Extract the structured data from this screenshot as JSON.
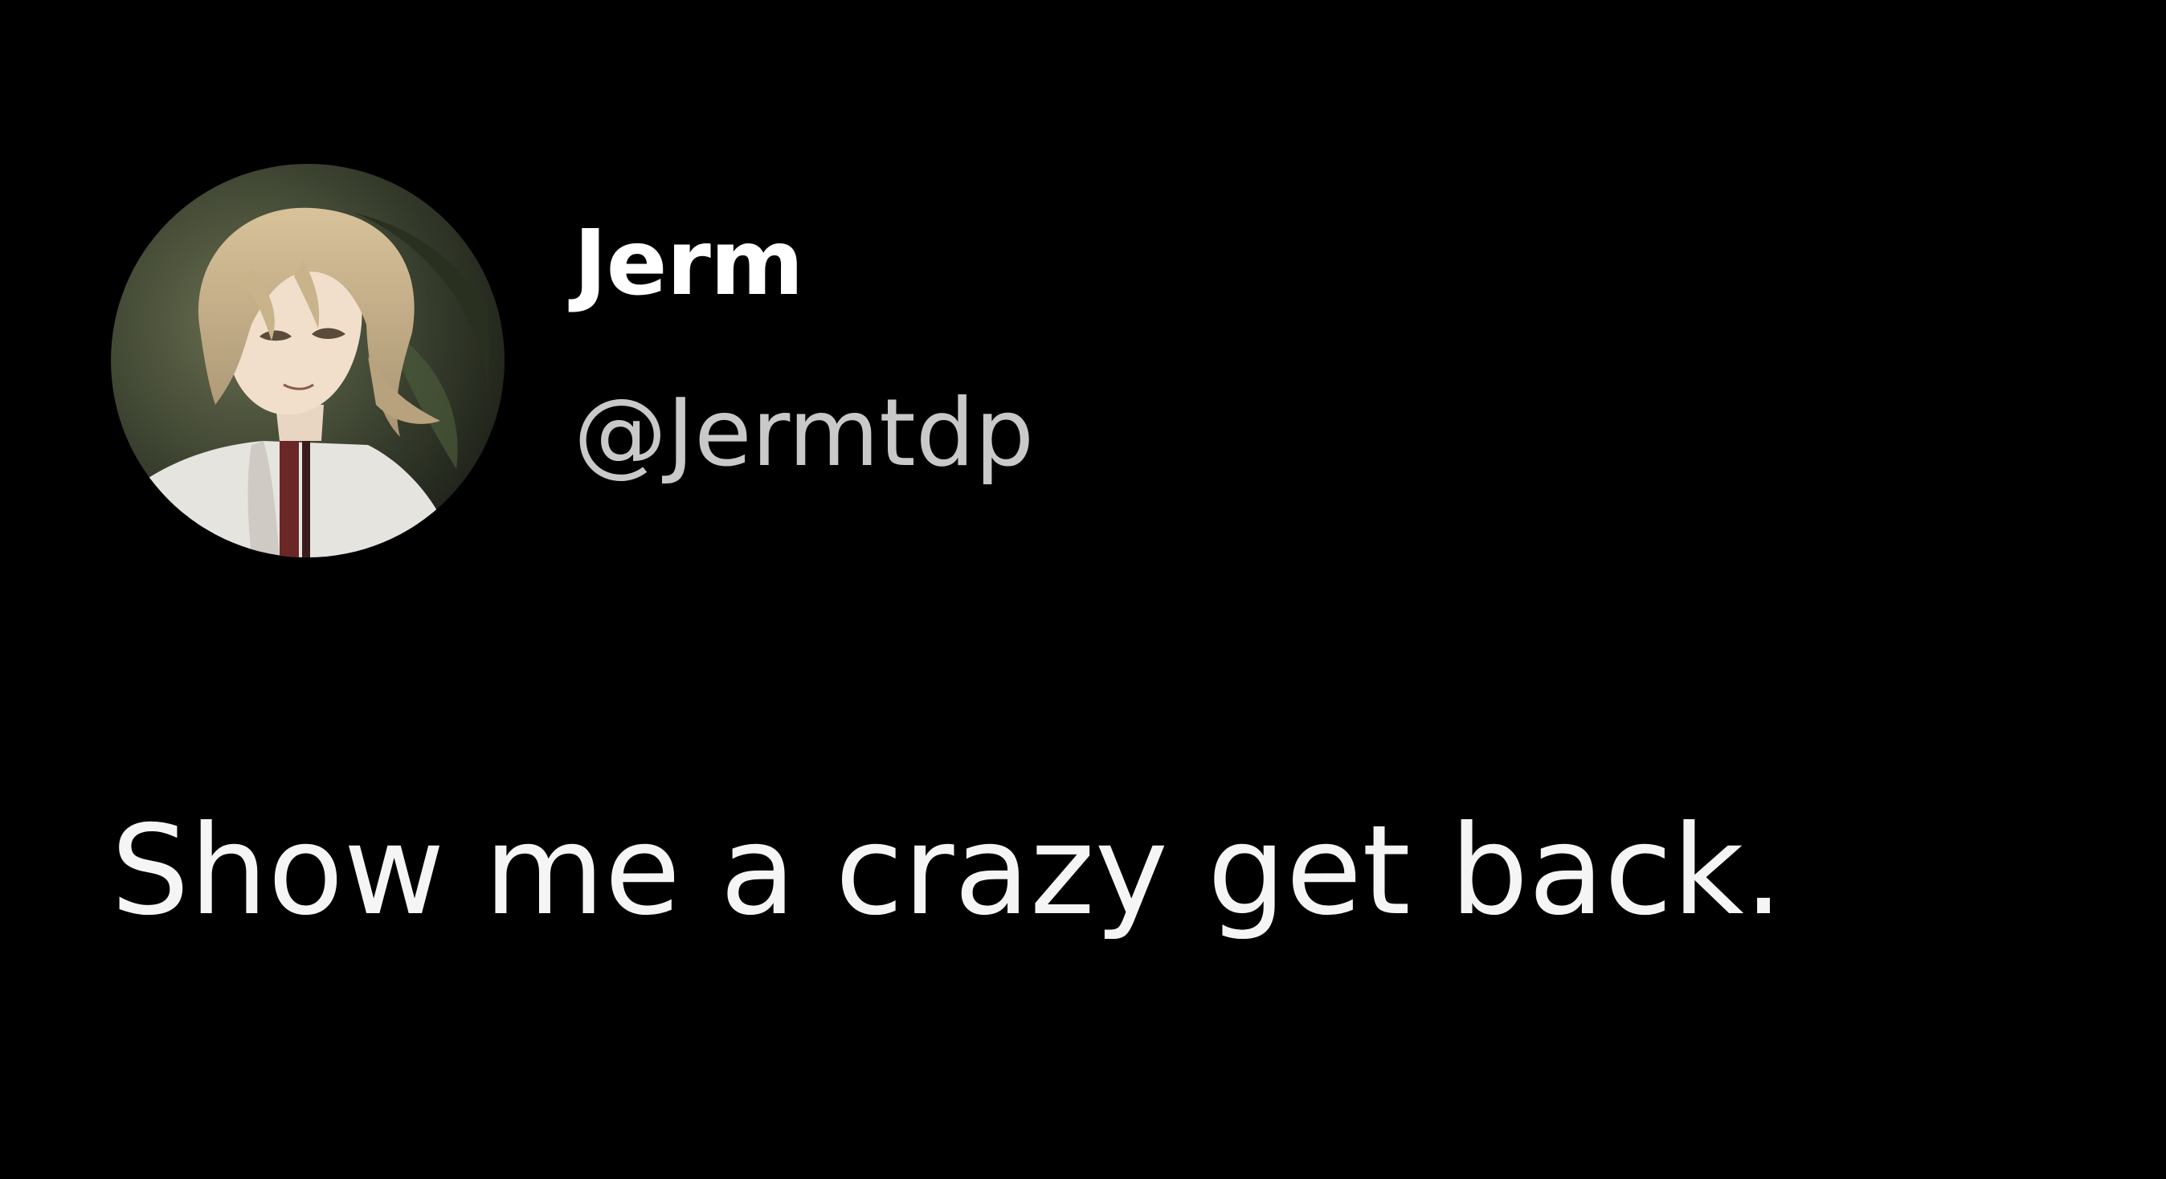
{
  "post": {
    "author": {
      "display_name": "Jerm",
      "handle": "@Jermtdp",
      "avatar": "anime-character-avatar"
    },
    "text": "Show me a crazy get back."
  },
  "colors": {
    "background": "#000000",
    "display_name": "#ffffff",
    "handle": "#c9c9c9",
    "text": "#f5f5f5"
  }
}
